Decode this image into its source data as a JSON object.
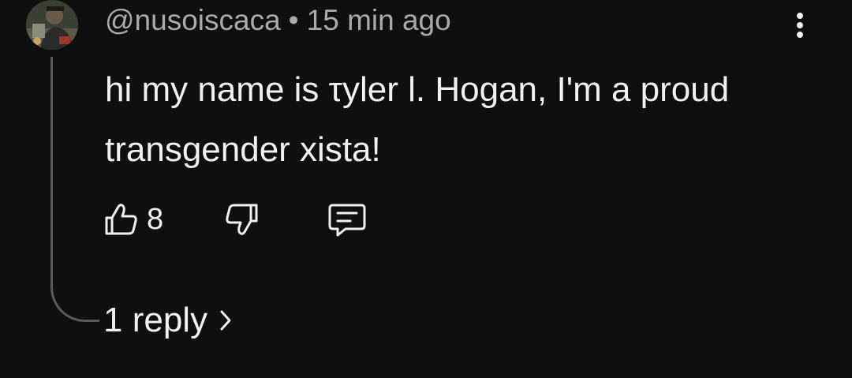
{
  "comment": {
    "username": "@nusoiscaca",
    "separator": "•",
    "timestamp": "15 min ago",
    "text": "hi my name is τyler l. Hogan, I'm a proud transgender xista!",
    "like_count": "8",
    "replies_label": "1 reply"
  },
  "icons": {
    "avatar": "avatar",
    "more": "vertical-ellipsis-icon",
    "like": "thumbs-up-icon",
    "dislike": "thumbs-down-icon",
    "reply": "comment-bubble-icon",
    "chevron": "chevron-right-icon"
  },
  "colors": {
    "background": "#0f0f0f",
    "primary_text": "#f1f1f1",
    "secondary_text": "#aaaaaa",
    "thread_line": "#5a5a5a"
  }
}
